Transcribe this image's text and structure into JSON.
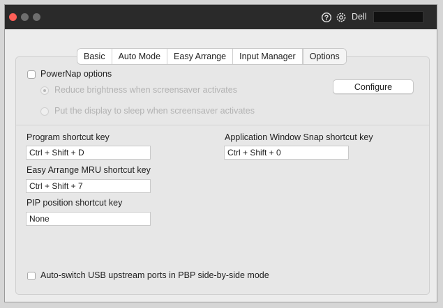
{
  "titlebar": {
    "brand": "Dell",
    "icons": [
      "help-icon",
      "gear-icon"
    ],
    "colors": {
      "close": "#ff5f57",
      "inactive": "#6d6d6d",
      "bar": "#2a2a2a"
    }
  },
  "tabs": [
    {
      "label": "Basic",
      "active": false
    },
    {
      "label": "Auto Mode",
      "active": false
    },
    {
      "label": "Easy Arrange",
      "active": false
    },
    {
      "label": "Input Manager",
      "active": false
    },
    {
      "label": "Options",
      "active": true
    }
  ],
  "powernap": {
    "label": "PowerNap options",
    "checked": false,
    "options": [
      {
        "label": "Reduce brightness when screensaver activates",
        "selected": true,
        "enabled": false
      },
      {
        "label": "Put the display to sleep when screensaver activates",
        "selected": false,
        "enabled": false
      }
    ],
    "configure_label": "Configure"
  },
  "shortcuts": {
    "program": {
      "label": "Program shortcut key",
      "value": "Ctrl + Shift + D"
    },
    "easy_arrange_mru": {
      "label": "Easy Arrange MRU shortcut key",
      "value": "Ctrl + Shift + 7"
    },
    "pip_position": {
      "label": "PIP position shortcut key",
      "value": "None"
    },
    "window_snap": {
      "label": "Application Window Snap shortcut key",
      "value": "Ctrl + Shift + 0"
    }
  },
  "usb_switch": {
    "label": "Auto-switch USB upstream ports in PBP side-by-side mode",
    "checked": false
  }
}
